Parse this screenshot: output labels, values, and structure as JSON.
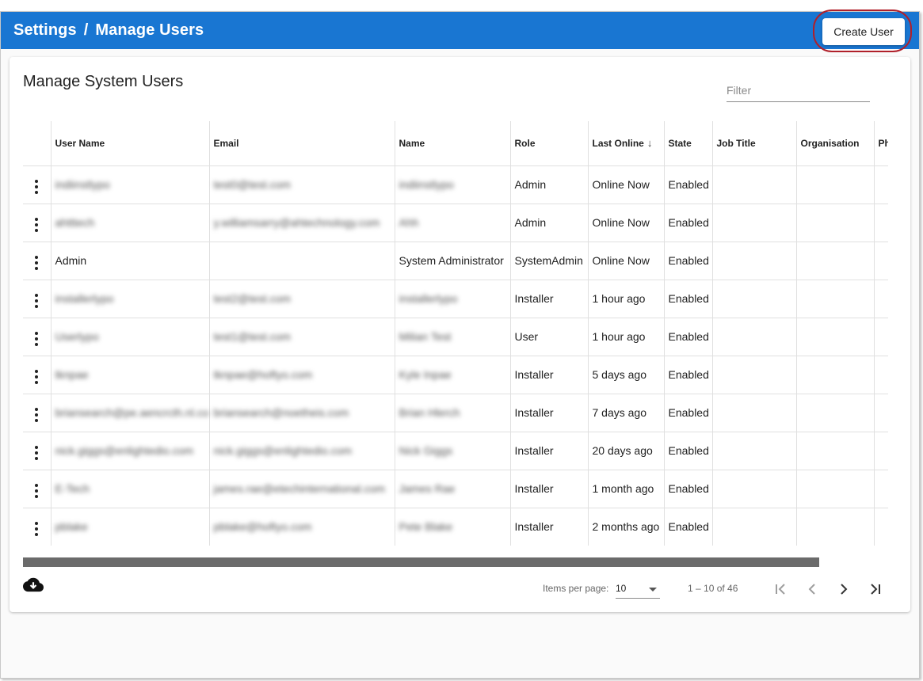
{
  "header": {
    "breadcrumb": [
      "Settings",
      "/",
      "Manage Users"
    ],
    "create_user_label": "Create User",
    "bar_color": "#1976d2",
    "highlight_color": "#b0202a"
  },
  "card": {
    "title": "Manage System Users",
    "filter_placeholder": "Filter"
  },
  "table": {
    "columns": [
      "",
      "User Name",
      "Email",
      "Name",
      "Role",
      "Last Online",
      "State",
      "Job Title",
      "Organisation",
      "Ph"
    ],
    "sort_icon": "arrow-down-icon",
    "rows": [
      {
        "user_name": "indiinstlypo",
        "email": "test0@test.com",
        "name": "indiinstlypo",
        "role": "Admin",
        "last_online": "Online Now",
        "state": "Enabled",
        "blur": true
      },
      {
        "user_name": "ahtttech",
        "email": "y.williamsarry@ahtechnology.com",
        "name": "Ahh",
        "role": "Admin",
        "last_online": "Online Now",
        "state": "Enabled",
        "blur": true
      },
      {
        "user_name": "Admin",
        "email": "",
        "name": "System Administrator",
        "role": "SystemAdmin",
        "last_online": "Online Now",
        "state": "Enabled",
        "blur": false
      },
      {
        "user_name": "installerlypo",
        "email": "test2@test.com",
        "name": "installerlypo",
        "role": "Installer",
        "last_online": "1 hour ago",
        "state": "Enabled",
        "blur": true
      },
      {
        "user_name": "Userlypo",
        "email": "test1@test.com",
        "name": "Milian Test",
        "role": "User",
        "last_online": "1 hour ago",
        "state": "Enabled",
        "blur": true
      },
      {
        "user_name": "tknpae",
        "email": "tknpae@hoftyo.com",
        "name": "Kyle Inpae",
        "role": "Installer",
        "last_online": "5 days ago",
        "state": "Enabled",
        "blur": true
      },
      {
        "user_name": "briansearch@pe.aencrcth.nl.co",
        "email": "briansearch@noetheis.com",
        "name": "Brian Hlerch",
        "role": "Installer",
        "last_online": "7 days ago",
        "state": "Enabled",
        "blur": true
      },
      {
        "user_name": "nick.giggs@enlightedio.com",
        "email": "nick.giggs@enlightedio.com",
        "name": "Nick Giggs",
        "role": "Installer",
        "last_online": "20 days ago",
        "state": "Enabled",
        "blur": true
      },
      {
        "user_name": "E-Tech",
        "email": "james.rae@etechinternational.com",
        "name": "James Rae",
        "role": "Installer",
        "last_online": "1 month ago",
        "state": "Enabled",
        "blur": true
      },
      {
        "user_name": "pblake",
        "email": "pblake@hoftyo.com",
        "name": "Pete Blake",
        "role": "Installer",
        "last_online": "2 months ago",
        "state": "Enabled",
        "blur": true
      }
    ]
  },
  "footer": {
    "download_icon": "cloud-download-icon",
    "items_per_page_label": "Items per page:",
    "items_per_page_value": "10",
    "range_label": "1 – 10 of 46",
    "pager_icons": [
      "first-page-icon",
      "previous-page-icon",
      "next-page-icon",
      "last-page-icon"
    ],
    "scroll_fraction": 0.92
  }
}
